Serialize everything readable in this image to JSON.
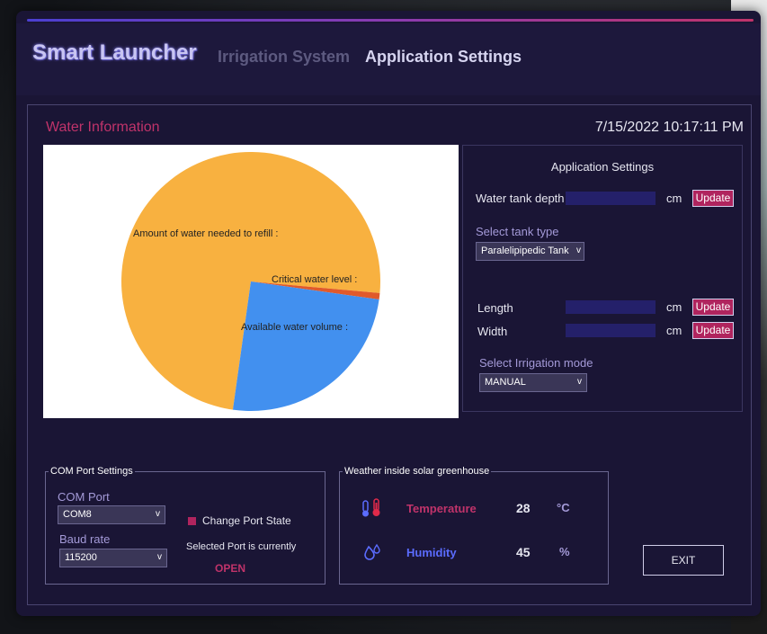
{
  "app": {
    "brand": "Smart Launcher",
    "nav": [
      "Irrigation System",
      "Application Settings"
    ]
  },
  "main": {
    "section_title": "Water Information",
    "datetime": "7/15/2022 10:17:11 PM"
  },
  "chart_data": {
    "type": "pie",
    "slices": [
      {
        "label": "Amount of water needed to refill :",
        "value": 74.2,
        "color": "#f8b140"
      },
      {
        "label": "Critical water level :",
        "value": 0.8,
        "color": "#e05a2b"
      },
      {
        "label": "Available water volume :",
        "value": 25.0,
        "color": "#4290ef"
      }
    ]
  },
  "settings": {
    "title": "Application Settings",
    "tank_depth_label": "Water tank depth",
    "unit": "cm",
    "update_label": "Update",
    "tank_type_label": "Select tank type",
    "tank_type_value": "Paralelipipedic Tank",
    "length_label": "Length",
    "width_label": "Width",
    "mode_label": "Select Irrigation mode",
    "mode_value": "MANUAL",
    "arrow": "v"
  },
  "com": {
    "title": "COM Port Settings",
    "port_label": "COM Port",
    "port_value": "COM8",
    "baud_label": "Baud rate",
    "baud_value": "115200",
    "change_label": "Change Port State",
    "status_label": "Selected Port is currently",
    "status_value": "OPEN"
  },
  "weather": {
    "title": "Weather inside solar greenhouse",
    "temp_label": "Temperature",
    "temp_value": "28",
    "temp_unit": "°C",
    "hum_label": "Humidity",
    "hum_value": "45",
    "hum_unit": "%"
  },
  "exit_label": "EXIT",
  "colors": {
    "accent": "#c0336a",
    "humidity": "#5b6cff",
    "panel": "#1a1535"
  }
}
